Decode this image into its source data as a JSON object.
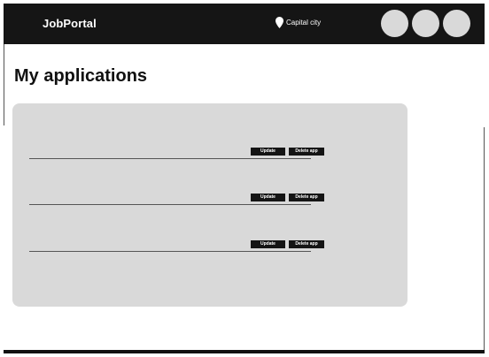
{
  "header": {
    "brand": "JobPortal",
    "location": "Capital city",
    "location_icon": "map-pin-icon",
    "avatars": 3
  },
  "page": {
    "title": "My applications"
  },
  "applications": [
    {
      "update_label": "Update",
      "delete_label": "Delete app"
    },
    {
      "update_label": "Update",
      "delete_label": "Delete app"
    },
    {
      "update_label": "Update",
      "delete_label": "Delete app"
    }
  ],
  "colors": {
    "header_bg": "#151515",
    "panel_bg": "#d9d9d9",
    "button_bg": "#141414",
    "avatar_bg": "#d9d9d9"
  }
}
